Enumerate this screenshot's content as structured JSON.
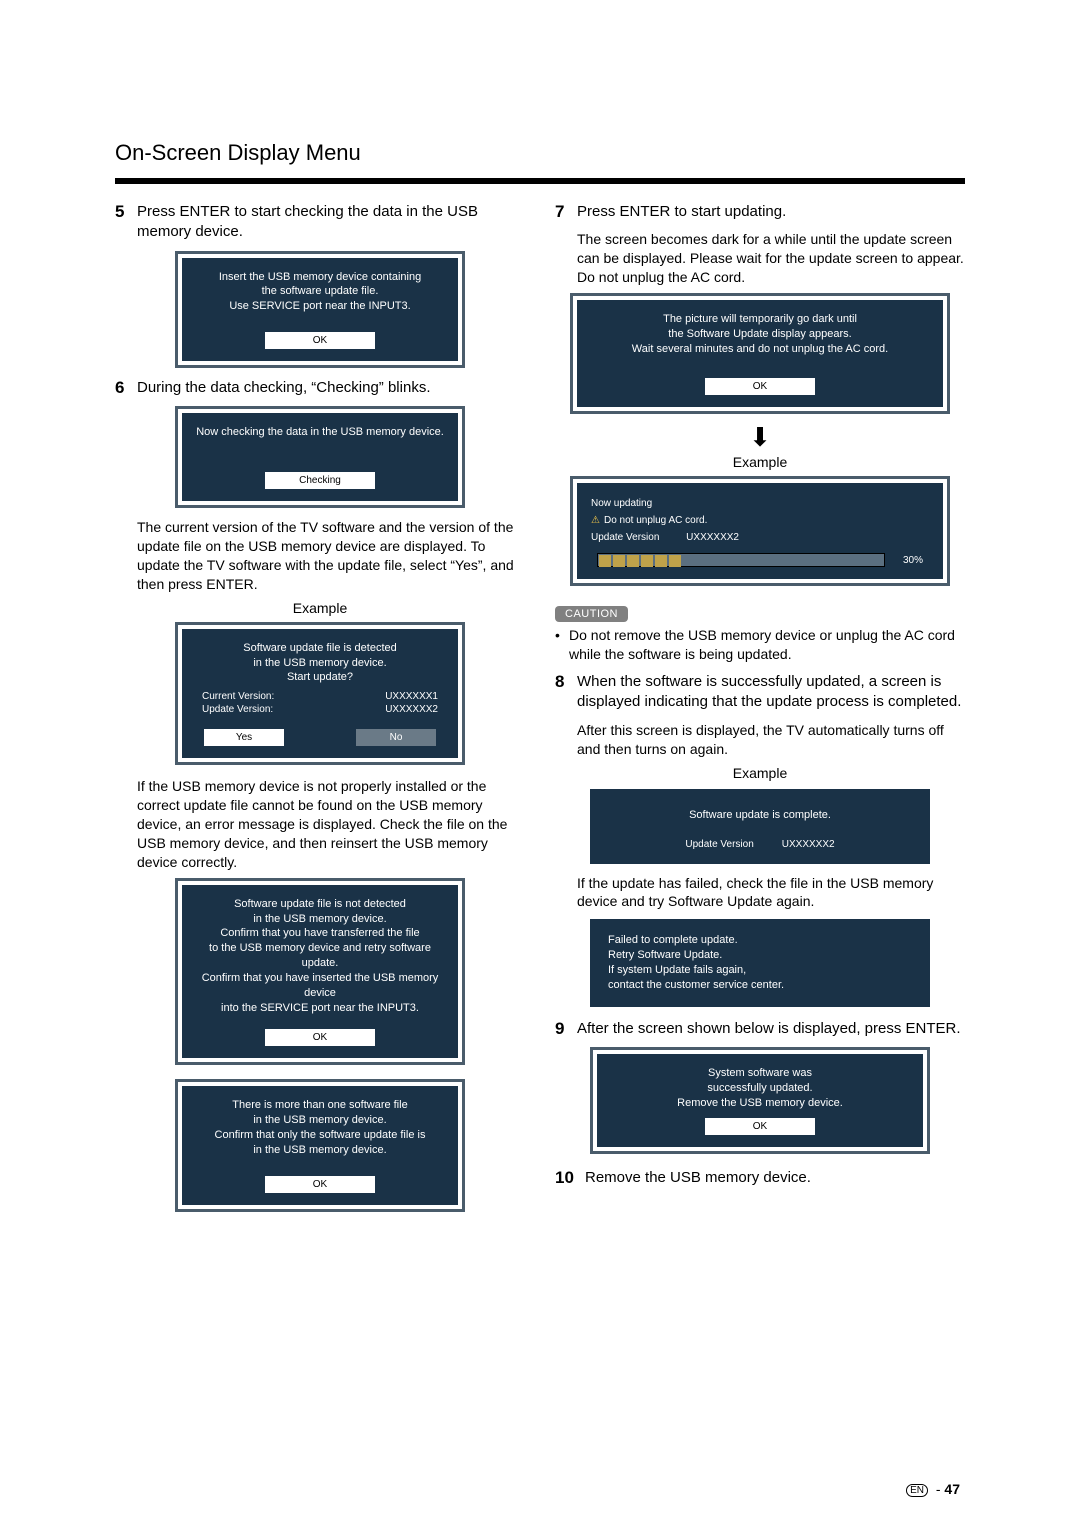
{
  "header": {
    "title": "On-Screen Display Menu"
  },
  "left": {
    "s5": {
      "num": "5",
      "text": "Press ENTER to start checking the data in the USB memory device.",
      "panel": {
        "msg": "Insert the USB memory device containing\nthe software update ﬁle.\nUse SERVICE port near the INPUT3.",
        "ok": "OK"
      }
    },
    "s6": {
      "num": "6",
      "text": "During the data checking, “Checking” blinks.",
      "panel_checking": {
        "msg": "Now checking the data in the USB memory device.",
        "btn": "Checking"
      },
      "desc1": "The current version of the TV software and the version of the update ﬁle on the USB memory device are displayed. To update the TV software with the update ﬁle, select “Yes”, and then press ENTER.",
      "example": "Example",
      "panel_version": {
        "msg": "Software update ﬁle is detected\nin the USB memory device.\nStart update?",
        "cur_lab": "Current Version:",
        "cur_val": "UXXXXXX1",
        "upd_lab": "Update Version:",
        "upd_val": "UXXXXXX2",
        "yes": "Yes",
        "no": "No"
      },
      "desc2": "If the USB memory device is not properly installed or the correct update ﬁle cannot be found on the USB memory device, an error message is displayed. Check the ﬁle on the USB memory device, and then reinsert the USB memory device correctly.",
      "panel_notdetected": {
        "msg": "Software update ﬁle is not detected\nin the USB memory device.\nConﬁrm that you have transferred the ﬁle\nto the USB memory device and retry software update.\nConﬁrm that you have inserted the USB memory device\ninto the SERVICE port near the INPUT3.",
        "ok": "OK"
      },
      "panel_multiple": {
        "msg": "There is more than one software ﬁle\nin the USB memory device.\nConﬁrm that only the software update ﬁle is\nin the USB memory device.",
        "ok": "OK"
      }
    }
  },
  "right": {
    "s7": {
      "num": "7",
      "text": "Press ENTER to start updating.",
      "sub": "The screen becomes dark for a while until the update screen can be displayed. Please wait for the update screen to appear. Do not unplug the AC cord.",
      "panel_dark": {
        "msg": "The picture will temporarily go dark until\nthe Software Update display appears.\nWait several minutes and do not unplug the AC cord.",
        "ok": "OK"
      },
      "arrow": "⬇",
      "example": "Example",
      "panel_updating": {
        "line1": "Now updating",
        "line2": "Do not unplug AC cord.",
        "upd_lab": "Update Version",
        "upd_val": "UXXXXXX2",
        "pct": "30%"
      }
    },
    "caution": {
      "label": "CAUTION",
      "text": "Do not remove the USB memory device or unplug the AC cord while the software is being updated."
    },
    "s8": {
      "num": "8",
      "text": "When the software is successfully updated, a screen is displayed indicating that the update process is completed.",
      "sub": "After this screen is displayed, the TV automatically turns off and then turns on again.",
      "example": "Example",
      "panel_complete": {
        "msg": "Software update is complete.",
        "upd_lab": "Update Version",
        "upd_val": "UXXXXXX2"
      },
      "desc2": "If the update has failed, check the ﬁle in the USB memory device and try Software Update again.",
      "panel_fail": {
        "l1": "Failed to complete update.",
        "l2": "Retry Software Update.",
        "l3": "If system Update fails again,",
        "l4": "contact the customer service center."
      }
    },
    "s9": {
      "num": "9",
      "text": "After the screen shown below is displayed, press ENTER.",
      "panel": {
        "msg": "System software was\nsuccessfully updated.\nRemove the USB memory device.",
        "ok": "OK"
      }
    },
    "s10": {
      "num": "10",
      "text": "Remove the USB memory device."
    }
  },
  "footer": {
    "en": "EN",
    "sep": "-",
    "page": "47"
  }
}
